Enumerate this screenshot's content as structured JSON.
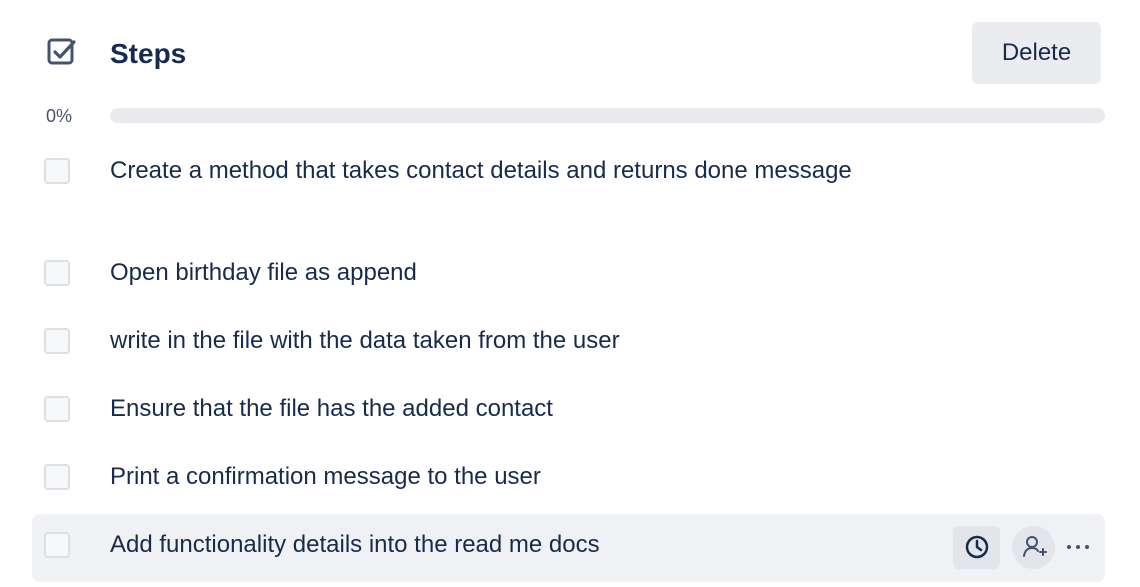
{
  "checklist": {
    "title": "Steps",
    "title_icon": "checkbox-checked-icon",
    "delete_label": "Delete",
    "progress": {
      "label": "0%",
      "value": 0
    },
    "items": [
      {
        "label": "Create a method that takes contact details and returns done message",
        "checked": false
      },
      {
        "label": "Open birthday file as append",
        "checked": false
      },
      {
        "label": "write in the file with the data taken from the user",
        "checked": false
      },
      {
        "label": "Ensure that the file has the added contact",
        "checked": false
      },
      {
        "label": "Print a confirmation message to the user",
        "checked": false
      },
      {
        "label": "Add functionality details into the read me docs",
        "checked": false,
        "actions": [
          "clock-icon",
          "add-member-icon",
          "more-horizontal-icon"
        ]
      }
    ]
  },
  "colors": {
    "text": "#172b4d",
    "muted_text": "#44546f",
    "button_background": "#eaecf0",
    "progress_track": "#e8eaee",
    "hover_row": "#f0f1f4"
  }
}
